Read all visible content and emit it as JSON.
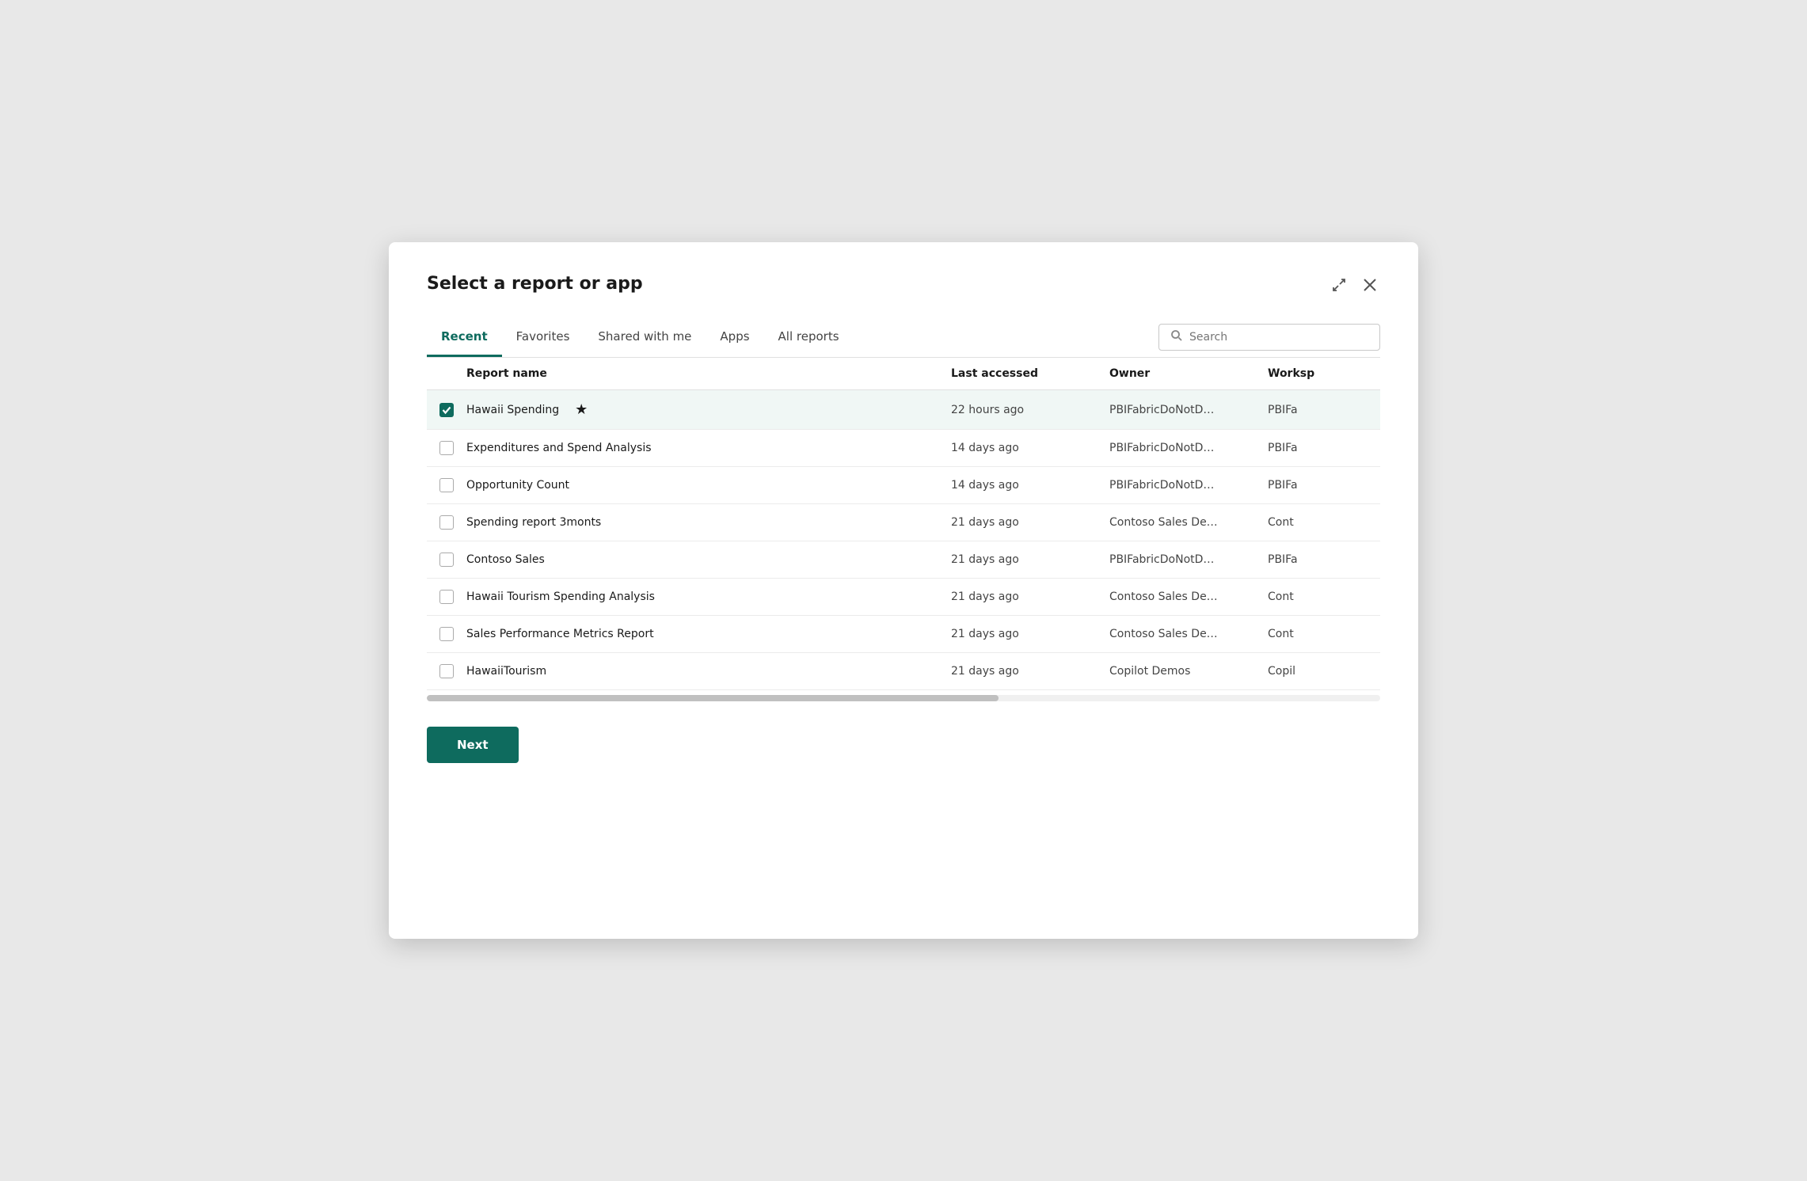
{
  "dialog": {
    "title": "Select a report or app"
  },
  "tabs": [
    {
      "id": "recent",
      "label": "Recent",
      "active": true
    },
    {
      "id": "favorites",
      "label": "Favorites",
      "active": false
    },
    {
      "id": "shared-with-me",
      "label": "Shared with me",
      "active": false
    },
    {
      "id": "apps",
      "label": "Apps",
      "active": false
    },
    {
      "id": "all-reports",
      "label": "All reports",
      "active": false
    }
  ],
  "search": {
    "placeholder": "Search"
  },
  "table": {
    "columns": [
      {
        "id": "checkbox",
        "label": ""
      },
      {
        "id": "report-name",
        "label": "Report name"
      },
      {
        "id": "last-accessed",
        "label": "Last accessed"
      },
      {
        "id": "owner",
        "label": "Owner"
      },
      {
        "id": "workspace",
        "label": "Worksp"
      }
    ],
    "rows": [
      {
        "id": 1,
        "selected": true,
        "name": "Hawaii Spending",
        "starred": true,
        "lastAccessed": "22 hours ago",
        "owner": "PBIFabricDoNotD…",
        "workspace": "PBIFa"
      },
      {
        "id": 2,
        "selected": false,
        "name": "Expenditures and Spend Analysis",
        "starred": false,
        "lastAccessed": "14 days ago",
        "owner": "PBIFabricDoNotD…",
        "workspace": "PBIFa"
      },
      {
        "id": 3,
        "selected": false,
        "name": "Opportunity Count",
        "starred": false,
        "lastAccessed": "14 days ago",
        "owner": "PBIFabricDoNotD…",
        "workspace": "PBIFa"
      },
      {
        "id": 4,
        "selected": false,
        "name": "Spending report 3monts",
        "starred": false,
        "lastAccessed": "21 days ago",
        "owner": "Contoso Sales De…",
        "workspace": "Cont"
      },
      {
        "id": 5,
        "selected": false,
        "name": "Contoso Sales",
        "starred": false,
        "lastAccessed": "21 days ago",
        "owner": "PBIFabricDoNotD…",
        "workspace": "PBIFa"
      },
      {
        "id": 6,
        "selected": false,
        "name": "Hawaii Tourism Spending Analysis",
        "starred": false,
        "lastAccessed": "21 days ago",
        "owner": "Contoso Sales De…",
        "workspace": "Cont"
      },
      {
        "id": 7,
        "selected": false,
        "name": "Sales Performance Metrics Report",
        "starred": false,
        "lastAccessed": "21 days ago",
        "owner": "Contoso Sales De…",
        "workspace": "Cont"
      },
      {
        "id": 8,
        "selected": false,
        "name": "HawaiiTourism",
        "starred": false,
        "lastAccessed": "21 days ago",
        "owner": "Copilot Demos",
        "workspace": "Copil"
      }
    ]
  },
  "buttons": {
    "next": "Next"
  },
  "icons": {
    "expand": "⤢",
    "close": "✕",
    "search": "🔍",
    "star_filled": "★",
    "check": "✓"
  }
}
